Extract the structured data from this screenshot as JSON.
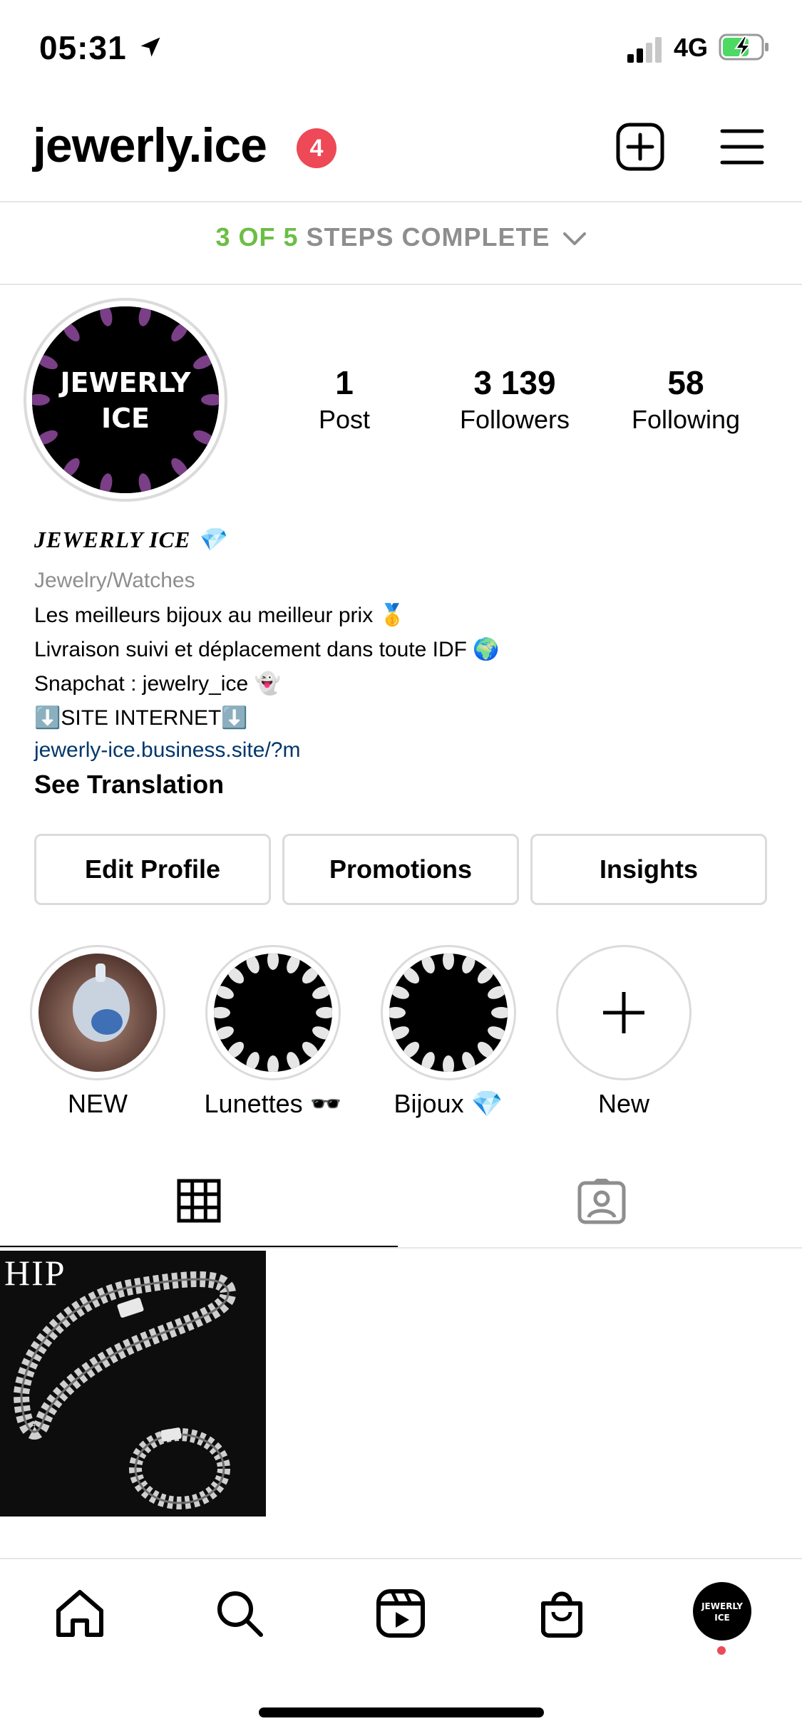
{
  "status_bar": {
    "time": "05:31",
    "network": "4G",
    "location_icon": "location-arrow-icon",
    "signal_icon": "signal-icon",
    "battery_icon": "battery-charging-icon"
  },
  "header": {
    "username": "jewerly.ice",
    "notification_count": "4",
    "add_icon": "plus-square-icon",
    "menu_icon": "hamburger-menu-icon"
  },
  "steps": {
    "done_text": "3 OF 5",
    "rest_text": "STEPS COMPLETE",
    "completed": 3,
    "total": 5,
    "chevron_icon": "chevron-down-icon"
  },
  "profile": {
    "avatar_text": [
      "JEWERLY",
      "ICE"
    ],
    "stats": [
      {
        "number": "1",
        "label": "Post"
      },
      {
        "number": "3 139",
        "label": "Followers"
      },
      {
        "number": "58",
        "label": "Following"
      }
    ]
  },
  "bio": {
    "name": "JEWERLY ICE 💎",
    "category": "Jewelry/Watches",
    "lines": [
      "Les meilleurs bijoux au meilleur prix 🥇",
      "Livraison suivi et déplacement dans toute IDF 🌍",
      "Snapchat : jewelry_ice 👻",
      "⬇️SITE INTERNET⬇️"
    ],
    "link": "jewerly-ice.business.site/?m",
    "see_translation": "See Translation"
  },
  "buttons": {
    "edit_profile": "Edit Profile",
    "promotions": "Promotions",
    "insights": "Insights"
  },
  "highlights": [
    {
      "label": "NEW"
    },
    {
      "label": "Lunettes 🕶️"
    },
    {
      "label": "Bijoux 💎"
    },
    {
      "label": "New"
    }
  ],
  "tabs": {
    "grid_icon": "grid-icon",
    "tagged_icon": "tagged-person-icon"
  },
  "posts": [
    {
      "overlay_text": "HIP"
    }
  ],
  "bottom_nav": {
    "items": [
      "home-icon",
      "search-icon",
      "reels-icon",
      "shop-icon",
      "profile-avatar"
    ]
  },
  "colors": {
    "badge": "#ed4956",
    "steps_done": "#6cbe45",
    "steps_rest": "#8e8e8e",
    "link": "#00376b",
    "border": "#dbdbdb"
  }
}
